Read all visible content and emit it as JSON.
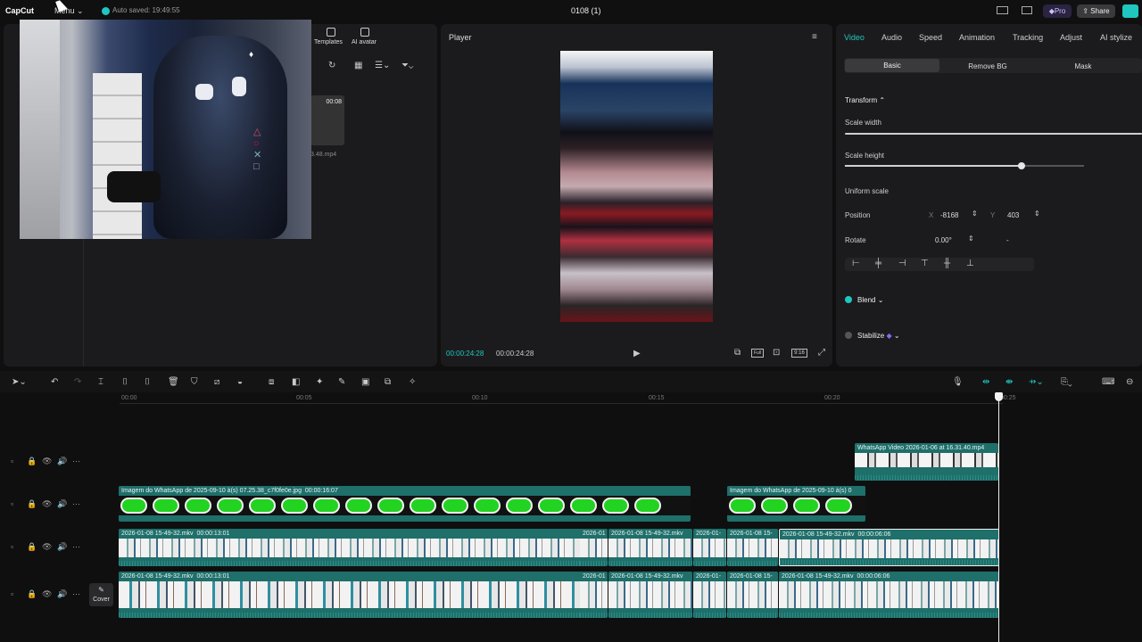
{
  "topbar": {
    "app_name": "CapCut",
    "menu_label": "Menu",
    "autosave": "Auto saved: 19:49:55",
    "project_title": "0108 (1)",
    "pro_label": "Pro",
    "share_label": "Share"
  },
  "media_panel": {
    "templates_label": "Templates",
    "ai_avatar_label": "AI avatar",
    "thumb_duration": "00:08",
    "thumb_filename": "3.48.mp4"
  },
  "player": {
    "title": "Player",
    "current_time": "00:00:24:28",
    "total_time": "00:00:24:28",
    "full_label": "Full",
    "ratio_label": "9:16"
  },
  "inspector": {
    "tabs": [
      "Video",
      "Audio",
      "Speed",
      "Animation",
      "Tracking",
      "Adjust",
      "AI stylize"
    ],
    "subtabs": [
      "Basic",
      "Remove BG",
      "Mask"
    ],
    "transform_label": "Transform",
    "scale_width_label": "Scale width",
    "scale_height_label": "Scale height",
    "uniform_scale_label": "Uniform scale",
    "position_label": "Position",
    "pos_x_axis": "X",
    "pos_x": "-8168",
    "pos_y_axis": "Y",
    "pos_y": "403",
    "rotate_label": "Rotate",
    "rotate_value": "0.00°",
    "rotate_dash": "-",
    "blend_label": "Blend",
    "stabilize_label": "Stabilize",
    "scale_height_level": 0.74
  },
  "ruler": {
    "ticks": [
      "00:00",
      "00:05",
      "00:10",
      "00:15",
      "00:20",
      "00:25"
    ]
  },
  "timeline": {
    "cover_label": "Cover",
    "overlay_clip_label": "WhatsApp Video 2026-01-06 at 16.31.40.mp4",
    "image_clip_1_label": "Imagem do WhatsApp de 2025-09-10 à(s) 07.25.38_c7f0fe0e.jpg",
    "image_clip_1_duration": "00:00:16:07",
    "image_clip_2_label": "Imagem do WhatsApp de 2025-09-10 à(s) 0",
    "main_clip_label": "2026-01-08 15-49-32.mkv",
    "main_clip_duration": "00:00:13:01",
    "short_clip_label_a": "2026-01",
    "short_clip_label_b": "2026-01-08 15-49-32.mkv",
    "short_clip_label_c": "2026-01-",
    "short_clip_label_d": "2026-01-08 15-",
    "selected_clip_label": "2026-01-08 15-49-32.mkv",
    "selected_clip_duration": "00:00:06:06",
    "bottom_clip_label": "2026-01-08 15-49-32.mkv",
    "bottom_clip_duration": "00:00:06:06"
  },
  "colors": {
    "accent": "#1fc7c0",
    "clip_teal": "#1f6f6a",
    "pro_purple": "#6a4fd8",
    "green_screen": "#22d322"
  }
}
